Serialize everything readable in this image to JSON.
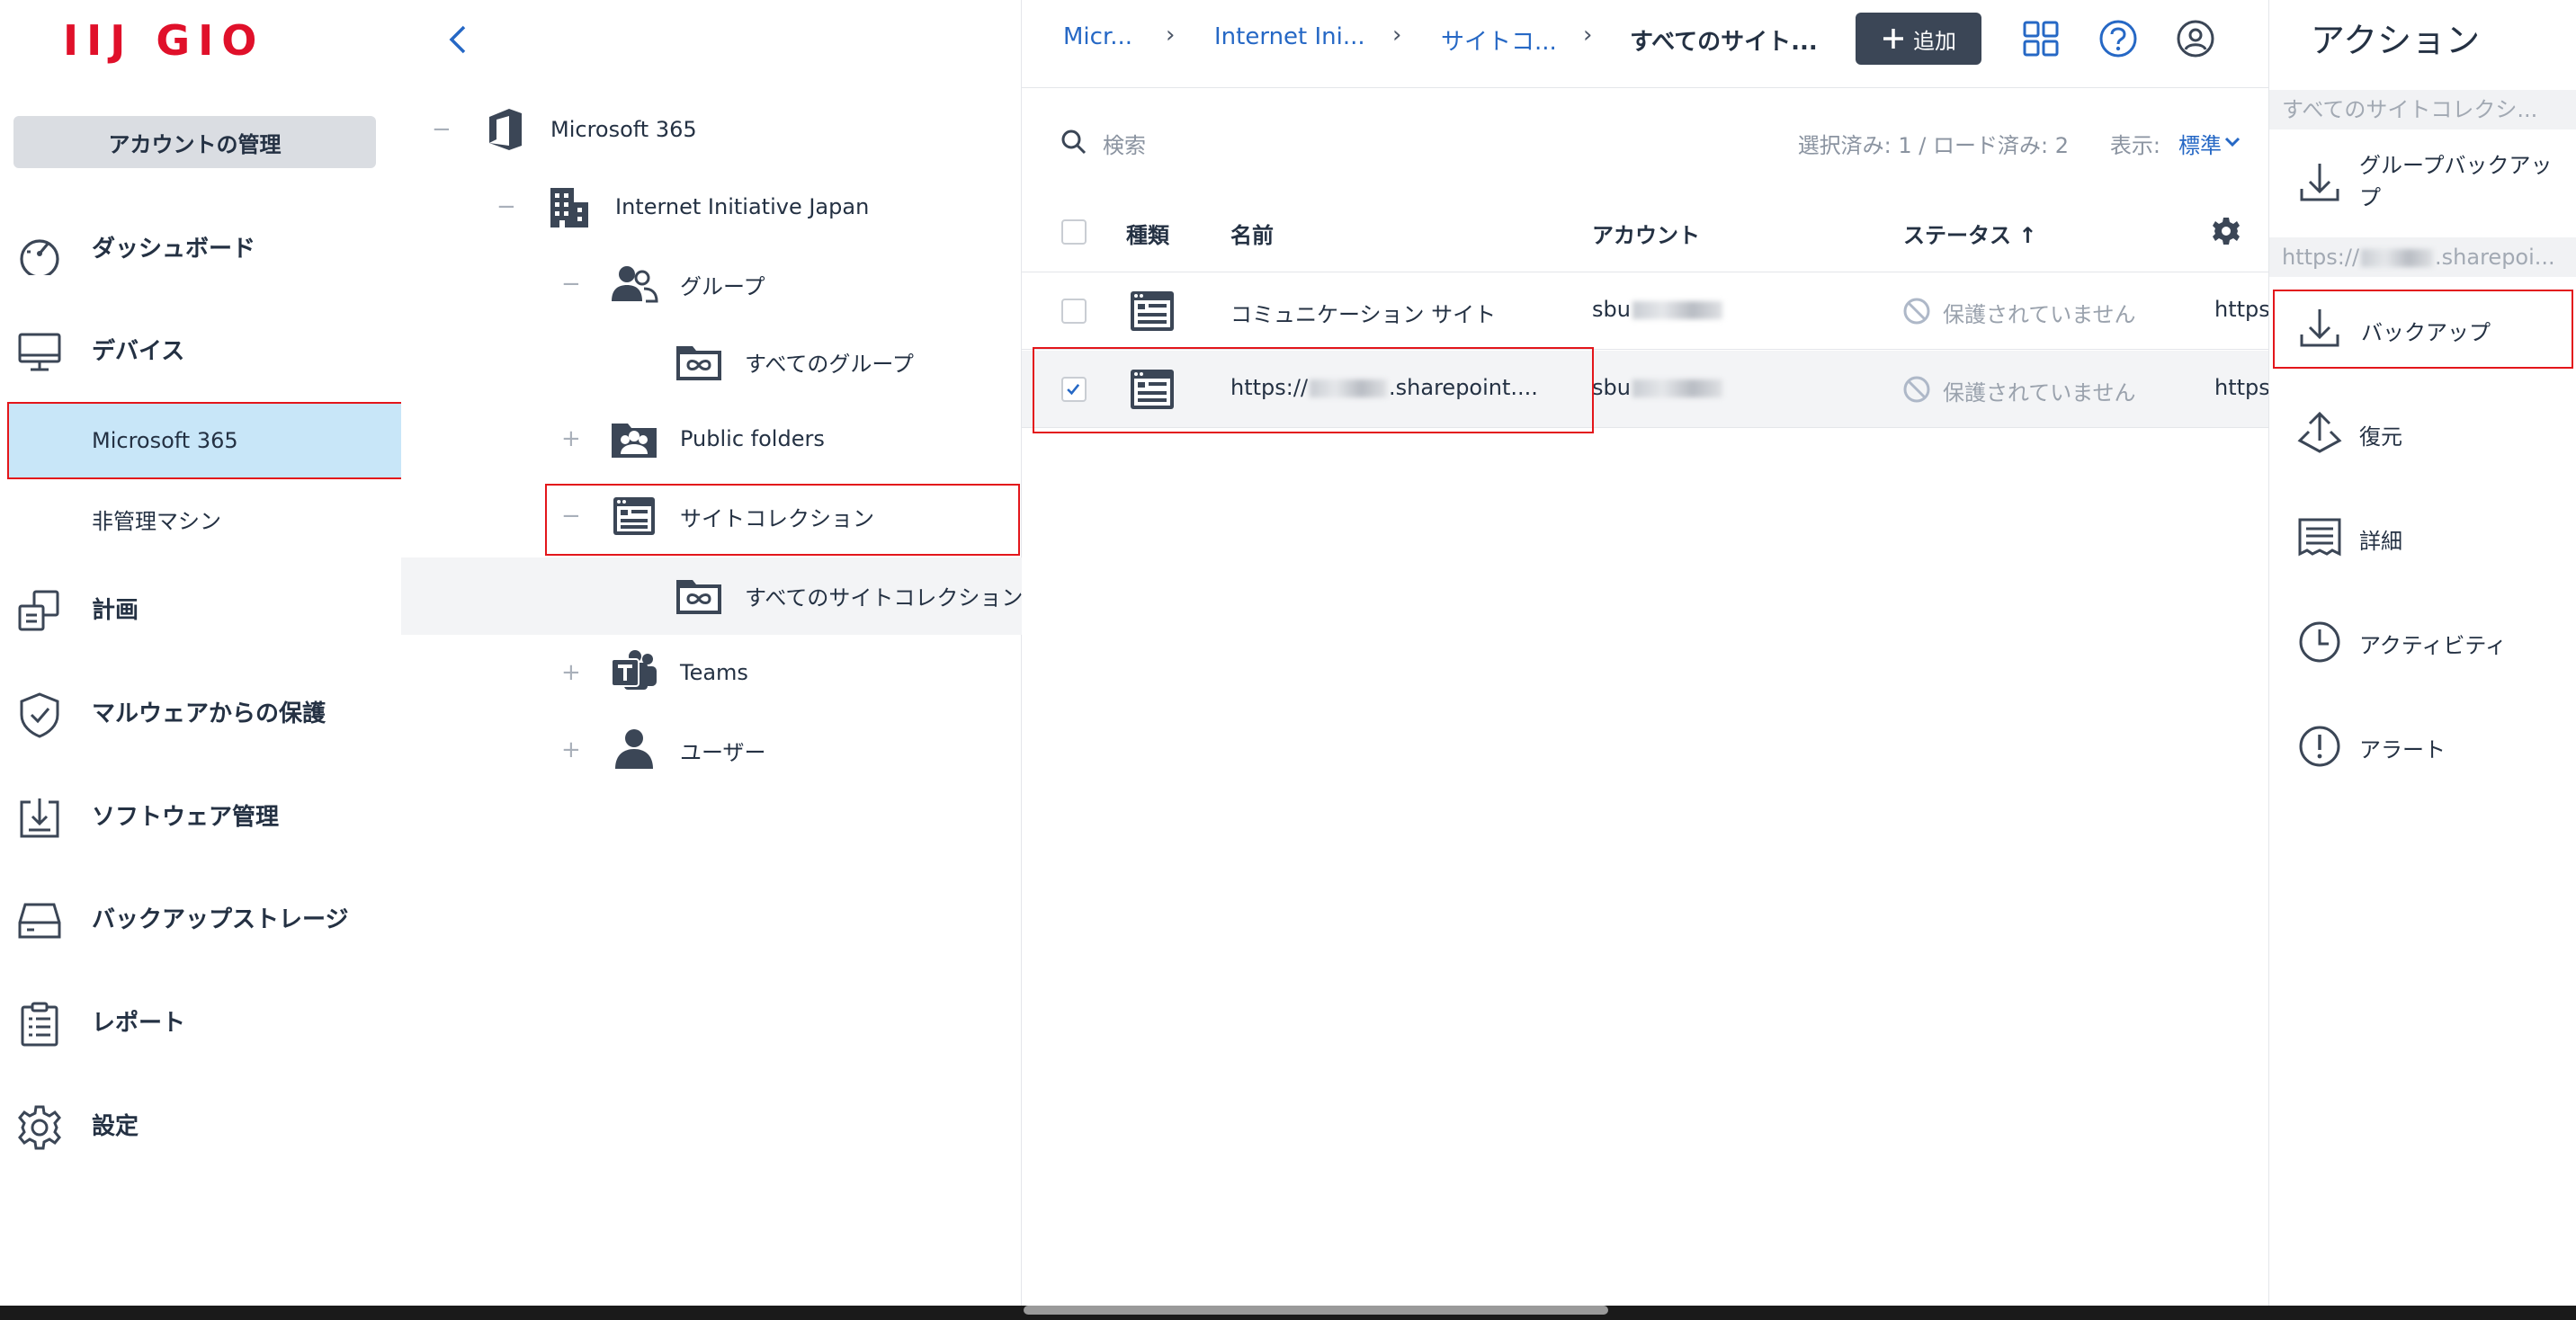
{
  "brand": {
    "logo_text": "IIJ GIO",
    "logo_color": "#e0102a"
  },
  "sidebar": {
    "account_button": "アカウントの管理",
    "items": [
      {
        "label": "ダッシュボード",
        "icon": "dashboard-icon"
      },
      {
        "label": "デバイス",
        "icon": "monitor-icon"
      },
      {
        "label": "計画",
        "icon": "plans-icon"
      },
      {
        "label": "マルウェアからの保護",
        "icon": "shield-icon"
      },
      {
        "label": "ソフトウェア管理",
        "icon": "software-icon"
      },
      {
        "label": "バックアップストレージ",
        "icon": "storage-icon"
      },
      {
        "label": "レポート",
        "icon": "report-icon"
      },
      {
        "label": "設定",
        "icon": "gear-icon"
      }
    ],
    "sub_items": [
      {
        "label": "Microsoft 365",
        "active": true
      },
      {
        "label": "非管理マシン",
        "active": false
      }
    ]
  },
  "tree": {
    "nodes": [
      {
        "label": "Microsoft 365",
        "toggle": "−",
        "icon": "office-icon"
      },
      {
        "label": "Internet Initiative Japan",
        "toggle": "−",
        "icon": "building-icon"
      },
      {
        "label": "グループ",
        "toggle": "−",
        "icon": "group-icon"
      },
      {
        "label": "すべてのグループ",
        "toggle": "",
        "icon": "all-folder-icon"
      },
      {
        "label": "Public folders",
        "toggle": "+",
        "icon": "public-folder-icon"
      },
      {
        "label": "サイトコレクション",
        "toggle": "−",
        "icon": "site-icon"
      },
      {
        "label": "すべてのサイトコレクション",
        "toggle": "",
        "icon": "all-folder-icon"
      },
      {
        "label": "Teams",
        "toggle": "+",
        "icon": "teams-icon"
      },
      {
        "label": "ユーザー",
        "toggle": "+",
        "icon": "user-icon"
      }
    ]
  },
  "topbar": {
    "breadcrumbs": [
      "Micr...",
      "Internet Ini...",
      "サイトコ...",
      "すべてのサイト..."
    ],
    "add_button": "追加"
  },
  "search": {
    "placeholder": "検索",
    "selection_info": "選択済み: 1 / ロード済み: 2",
    "view_label": "表示:",
    "view_value": "標準"
  },
  "table": {
    "headers": {
      "type": "種類",
      "name": "名前",
      "account": "アカウント",
      "status": "ステータス ↑"
    },
    "rows": [
      {
        "name": "コミュニケーション サイト",
        "account_prefix": "sbu",
        "status": "保護されていません",
        "url": "https:",
        "checked": false
      },
      {
        "name_prefix": "https://",
        "name_suffix": ".sharepoint....",
        "account_prefix": "sbu",
        "status": "保護されていません",
        "url": "https:",
        "checked": true
      }
    ]
  },
  "actions": {
    "title": "アクション",
    "section1": "すべてのサイトコレクシ...",
    "item_group_backup": "グループバックアップ",
    "section2_prefix": "https://",
    "section2_suffix": ".sharepoi...",
    "items": [
      {
        "label": "バックアップ",
        "icon": "download-icon"
      },
      {
        "label": "復元",
        "icon": "restore-icon"
      },
      {
        "label": "詳細",
        "icon": "details-icon"
      },
      {
        "label": "アクティビティ",
        "icon": "clock-icon"
      },
      {
        "label": "アラート",
        "icon": "alert-icon"
      }
    ]
  },
  "colors": {
    "accent": "#2668c5",
    "highlight": "#e3161b",
    "active_bg": "#c8e6f8",
    "text": "#243143"
  }
}
